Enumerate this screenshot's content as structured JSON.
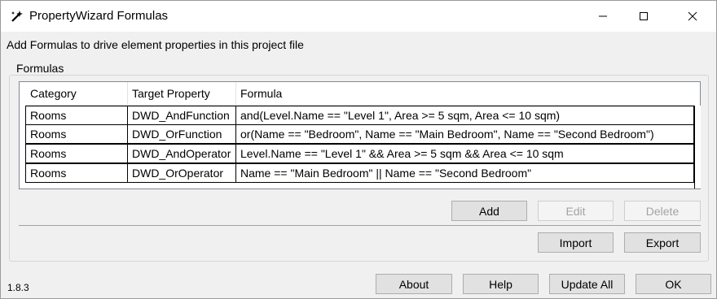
{
  "window": {
    "title": "PropertyWizard Formulas",
    "controls": {
      "minimize": "–",
      "maximize": "☐",
      "close": "✕"
    }
  },
  "description": "Add Formulas to drive element properties in this project file",
  "group": {
    "label": "Formulas"
  },
  "grid": {
    "columns": [
      "Category",
      "Target Property",
      "Formula"
    ],
    "rows": [
      {
        "category": "Rooms",
        "target": "DWD_AndFunction",
        "formula": "and(Level.Name == \"Level 1\", Area >= 5 sqm, Area <= 10 sqm)"
      },
      {
        "category": "Rooms",
        "target": "DWD_OrFunction",
        "formula": "or(Name == \"Bedroom\", Name == \"Main Bedroom\", Name == \"Second Bedroom\")"
      },
      {
        "category": "Rooms",
        "target": "DWD_AndOperator",
        "formula": "Level.Name == \"Level 1\" && Area >= 5 sqm && Area <= 10 sqm"
      },
      {
        "category": "Rooms",
        "target": "DWD_OrOperator",
        "formula": "Name == \"Main Bedroom\" || Name == \"Second Bedroom\""
      }
    ]
  },
  "buttons": {
    "add": "Add",
    "edit": "Edit",
    "delete": "Delete",
    "import": "Import",
    "export": "Export",
    "about": "About",
    "help": "Help",
    "update_all": "Update All",
    "ok": "OK"
  },
  "version": "1.8.3"
}
